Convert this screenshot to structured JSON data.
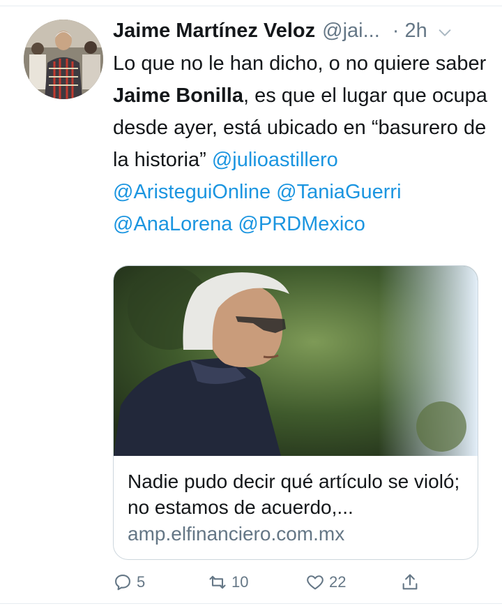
{
  "tweet": {
    "author_name": "Jaime Martínez Veloz",
    "author_handle": "@jai...",
    "time": "· 2h",
    "text": {
      "p1": "Lo que no le han dicho, o no quiere saber ",
      "bold": "Jaime Bonilla",
      "p2": ", es que el lugar que ocupa desde ayer, está ubicado en “basurero de la historia”  ",
      "mentions": [
        "@julioastillero",
        "@AristeguiOnline",
        "@TaniaGuerri",
        "@AnaLorena",
        "@PRDMexico"
      ]
    }
  },
  "card": {
    "title": "Nadie pudo decir qué artículo se violó; no estamos de acuerdo,...",
    "domain": "amp.elfinanciero.com.mx"
  },
  "actions": {
    "replies": "5",
    "retweets": "10",
    "likes": "22"
  },
  "icons": {
    "caret": "chevron-down-icon",
    "reply": "reply-icon",
    "retweet": "retweet-icon",
    "like": "heart-icon",
    "share": "share-icon"
  },
  "colors": {
    "link": "#1b95e0",
    "muted": "#657786",
    "text": "#14171a",
    "border": "#ccd6dd"
  }
}
